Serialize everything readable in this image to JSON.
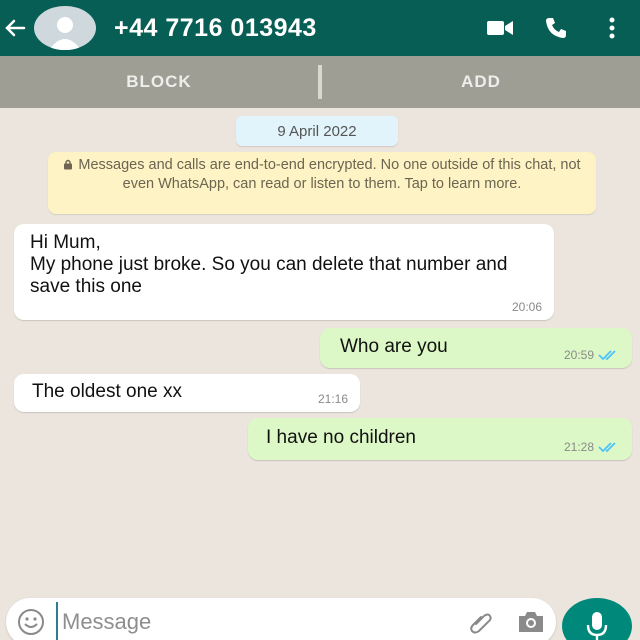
{
  "header": {
    "contact": "+44 7716 013943",
    "icons": [
      "back-arrow-icon",
      "avatar-icon",
      "video-call-icon",
      "phone-icon",
      "more-vert-icon"
    ]
  },
  "actions": {
    "block_label": "BLOCK",
    "add_label": "ADD"
  },
  "chat": {
    "date": "9 April 2022",
    "encryption_notice": "Messages and calls are end-to-end encrypted. No one outside of this chat, not even WhatsApp, can read or listen to them. Tap to learn more.",
    "messages": [
      {
        "direction": "in",
        "text": "Hi Mum,\nMy phone just broke. So you can delete that number and save this one",
        "time": "20:06"
      },
      {
        "direction": "out",
        "text": "Who are you",
        "time": "20:59",
        "status": "read"
      },
      {
        "direction": "in",
        "text": "The oldest one xx",
        "time": "21:16"
      },
      {
        "direction": "out",
        "text": "I have no children",
        "time": "21:28",
        "status": "read"
      }
    ]
  },
  "composer": {
    "placeholder": "Message",
    "value": "",
    "icons": [
      "emoji-icon",
      "attach-icon",
      "camera-icon",
      "mic-icon"
    ]
  },
  "colors": {
    "header": "#075e54",
    "action_bar": "#9e9e95",
    "chat_bg": "#ece5dd",
    "outgoing_bubble": "#dcf8c6",
    "incoming_bubble": "#ffffff",
    "notice_bg": "#fdf3c4",
    "read_ticks": "#4fc3f7",
    "mic_button": "#00897b"
  }
}
